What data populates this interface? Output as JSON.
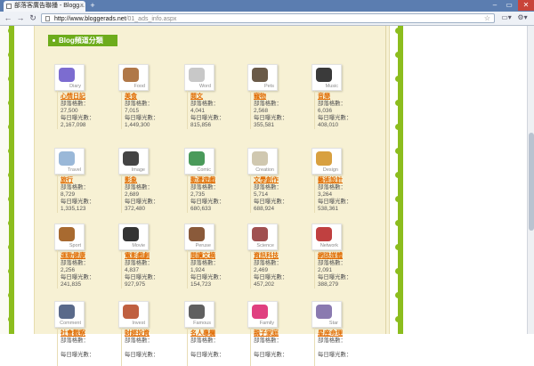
{
  "browser": {
    "tab_title": "部落客廣告聯播 - Blogg...",
    "tab_close": "×",
    "new_tab": "+",
    "url_host": "http://www.bloggerads.net",
    "url_path": "/01_ads_info.aspx",
    "back": "←",
    "forward": "→",
    "reload": "↻",
    "star": "☆",
    "win_min": "–",
    "win_max": "▭",
    "win_close": "✕",
    "page_menu": "▭▾",
    "tools_menu": "⚙▾"
  },
  "section": {
    "title": "Blog頻道分類"
  },
  "labels": {
    "blogs": "部落格數：",
    "views": "每日曝光數："
  },
  "categories": [
    {
      "name": "心情日記",
      "thumb": "Diary",
      "icon": "butterfly-icon",
      "color": "#7c6cd0",
      "blogs": "27,500",
      "views": "2,167,098"
    },
    {
      "name": "美食",
      "thumb": "Food",
      "icon": "cake-icon",
      "color": "#b07848",
      "blogs": "7,015",
      "views": "1,449,300"
    },
    {
      "name": "閱文",
      "thumb": "Word",
      "icon": "text-icon",
      "color": "#c8c8c8",
      "blogs": "4,041",
      "views": "815,856"
    },
    {
      "name": "寵物",
      "thumb": "Pets",
      "icon": "dog-icon",
      "color": "#6a5a48",
      "blogs": "2,568",
      "views": "355,581"
    },
    {
      "name": "音樂",
      "thumb": "Music",
      "icon": "guitar-icon",
      "color": "#3a3a3a",
      "blogs": "6,036",
      "views": "408,010"
    },
    {
      "name": "旅行",
      "thumb": "Travel",
      "icon": "plane-icon",
      "color": "#9ab8d8",
      "blogs": "8,729",
      "views": "1,335,123"
    },
    {
      "name": "影象",
      "thumb": "Image",
      "icon": "camera-icon",
      "color": "#444444",
      "blogs": "2,689",
      "views": "372,480"
    },
    {
      "name": "動漫遊戲",
      "thumb": "Comic",
      "icon": "dinosaur-icon",
      "color": "#4a9a5a",
      "blogs": "2,735",
      "views": "680,633"
    },
    {
      "name": "文學創作",
      "thumb": "Creation",
      "icon": "paper-icon",
      "color": "#d0c8b0",
      "blogs": "5,714",
      "views": "688,924"
    },
    {
      "name": "藝術設計",
      "thumb": "Design",
      "icon": "pencils-icon",
      "color": "#d8a040",
      "blogs": "3,264",
      "views": "538,361"
    },
    {
      "name": "運動健康",
      "thumb": "Sport",
      "icon": "glove-icon",
      "color": "#a86a30",
      "blogs": "2,256",
      "views": "241,835"
    },
    {
      "name": "電影戲劇",
      "thumb": "Movie",
      "icon": "clapper-icon",
      "color": "#333333",
      "blogs": "4,837",
      "views": "927,975"
    },
    {
      "name": "閱讀文摘",
      "thumb": "Peruse",
      "icon": "books-icon",
      "color": "#8a5a3a",
      "blogs": "1,924",
      "views": "154,723"
    },
    {
      "name": "資訊科技",
      "thumb": "Science",
      "icon": "robot-icon",
      "color": "#a05050",
      "blogs": "2,469",
      "views": "457,202"
    },
    {
      "name": "網路媒體",
      "thumb": "Network",
      "icon": "network-icon",
      "color": "#c04040",
      "blogs": "2,091",
      "views": "388,279"
    },
    {
      "name": "社會觀察",
      "thumb": "Comment",
      "icon": "comment-icon",
      "color": "#5a6a8a",
      "blogs": "",
      "views": ""
    },
    {
      "name": "財經投資",
      "thumb": "Invest",
      "icon": "chart-icon",
      "color": "#c06040",
      "blogs": "",
      "views": ""
    },
    {
      "name": "名人專欄",
      "thumb": "Famous",
      "icon": "mic-icon",
      "color": "#606060",
      "blogs": "",
      "views": ""
    },
    {
      "name": "親子家庭",
      "thumb": "Family",
      "icon": "balloons-icon",
      "color": "#e04080",
      "blogs": "",
      "views": ""
    },
    {
      "name": "星座命理",
      "thumb": "Star",
      "icon": "star-icon",
      "color": "#8a7ab0",
      "blogs": "",
      "views": ""
    }
  ]
}
